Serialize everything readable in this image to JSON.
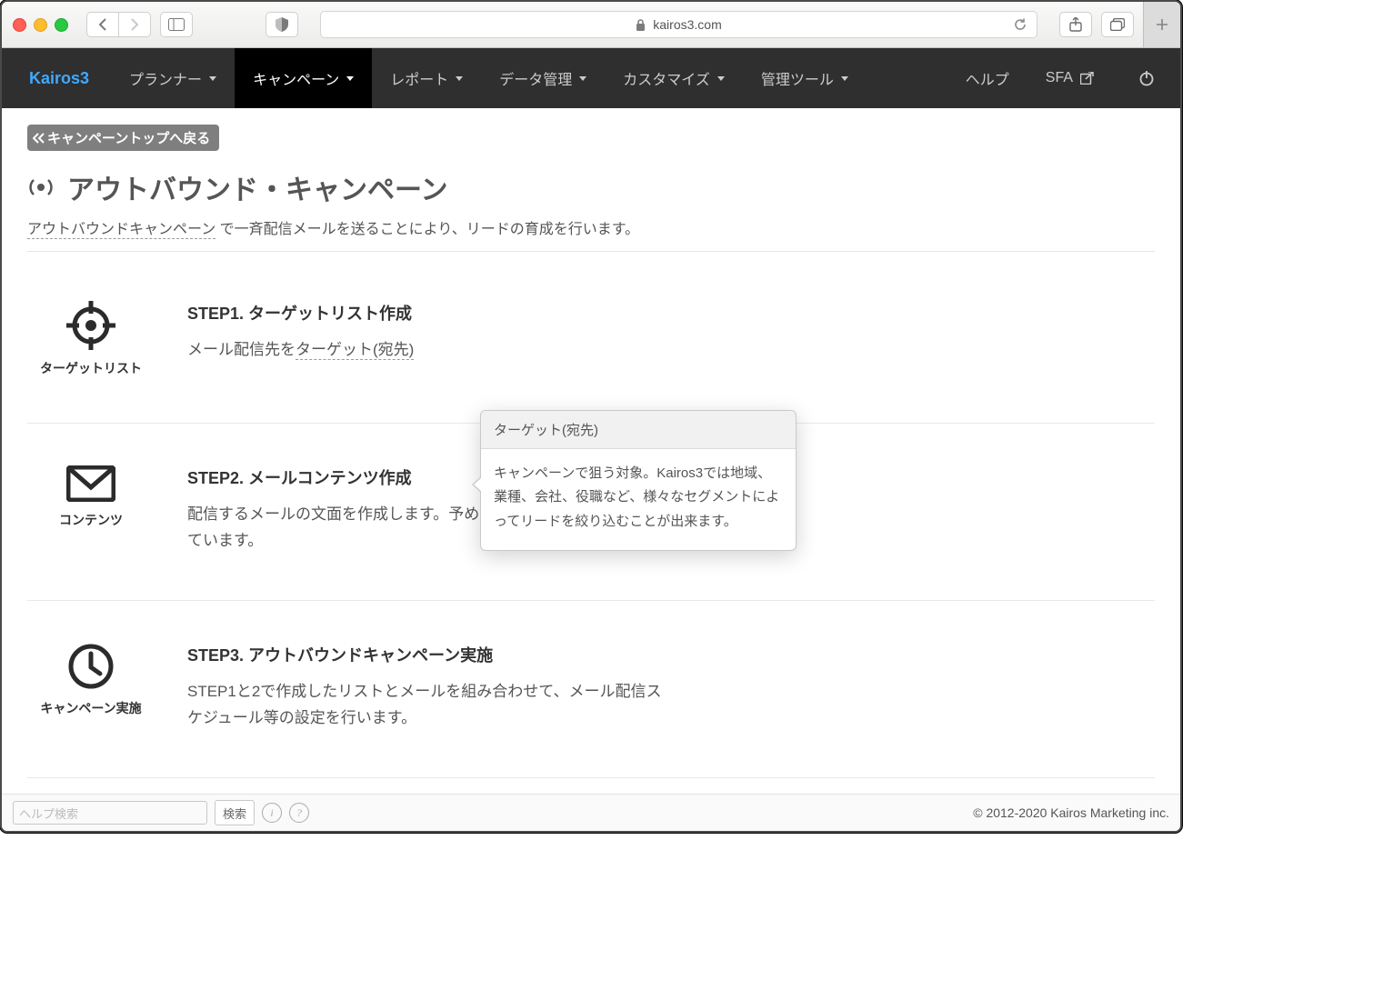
{
  "browser": {
    "url": "kairos3.com"
  },
  "nav": {
    "brand": "Kairos3",
    "items": [
      "プランナー",
      "キャンペーン",
      "レポート",
      "データ管理",
      "カスタマイズ",
      "管理ツール"
    ],
    "help": "ヘルプ",
    "sfa": "SFA"
  },
  "page": {
    "back": "キャンペーントップへ戻る",
    "title": "アウトバウンド・キャンペーン",
    "subtitle_term": "アウトバウンドキャンペーン",
    "subtitle_rest": " で一斉配信メールを送ることにより、リードの育成を行います。"
  },
  "steps": [
    {
      "icon": "ターゲットリスト",
      "title": "STEP1. ターゲットリスト作成",
      "desc_pre": "メール配信先を",
      "desc_term": "ターゲット(宛先)",
      "desc_post": ""
    },
    {
      "icon": "コンテンツ",
      "title": "STEP2. メールコンテンツ作成",
      "desc": "配信するメールの文面を作成します。予め文例やデザインが用意されています。"
    },
    {
      "icon": "キャンペーン実施",
      "title": "STEP3. アウトバウンドキャンペーン実施",
      "desc": "STEP1と2で作成したリストとメールを組み合わせて、メール配信スケジュール等の設定を行います。"
    }
  ],
  "tooltip": {
    "title": "ターゲット(宛先)",
    "body": "キャンペーンで狙う対象。Kairos3では地域、業種、会社、役職など、様々なセグメントによってリードを絞り込むことが出来ます。"
  },
  "footer": {
    "search_placeholder": "ヘルプ検索",
    "search_btn": "検索",
    "copyright": "© 2012-2020 Kairos Marketing inc."
  }
}
